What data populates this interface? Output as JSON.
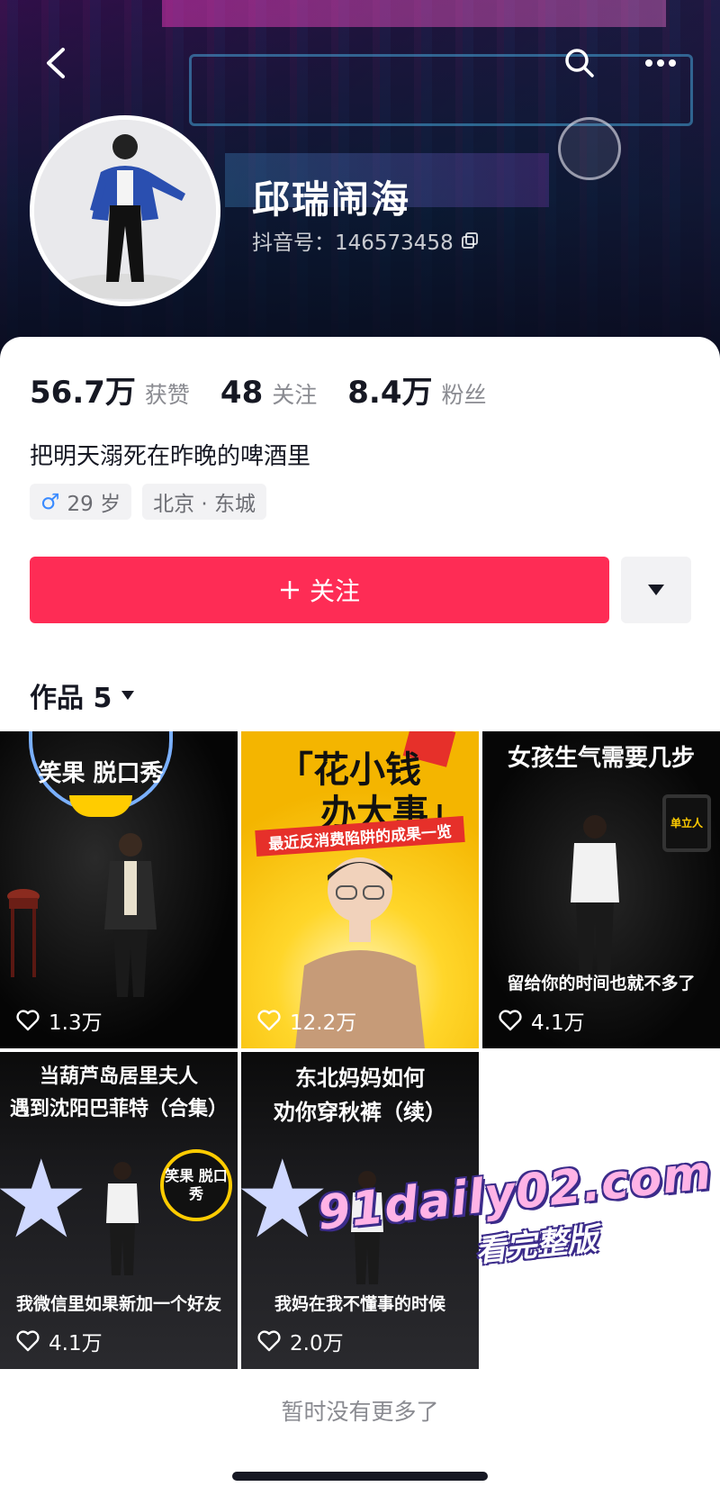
{
  "profile": {
    "nickname": "邱瑞闹海",
    "douyin_id": "抖音号：146573458",
    "bio": "把明天溺死在昨晚的啤酒里",
    "stats": [
      {
        "value": "56.7万",
        "label": "获赞"
      },
      {
        "value": "48",
        "label": "关注"
      },
      {
        "value": "8.4万",
        "label": "粉丝"
      }
    ],
    "tags": {
      "age": "29 岁",
      "location": "北京 · 东城"
    }
  },
  "actions": {
    "follow_label": "关注"
  },
  "works": {
    "header": "作品 5",
    "items": [
      {
        "likes": "1.3万",
        "badge_text": "笑果 脱口秀"
      },
      {
        "likes": "12.2万",
        "headline1": "「花小钱",
        "headline2": "办大事」",
        "subtitle": "最近反消费陷阱的成果一览"
      },
      {
        "likes": "4.1万",
        "title": "女孩生气需要几步",
        "bottom_caption": "留给你的时间也就不多了"
      },
      {
        "likes": "4.1万",
        "title_line1": "当葫芦岛居里夫人",
        "title_line2": "遇到沈阳巴菲特（合集）",
        "bottom_caption": "我微信里如果新加一个好友",
        "badge_text": "笑果 脱口秀"
      },
      {
        "likes": "2.0万",
        "title_line1": "东北妈妈如何",
        "title_line2": "劝你穿秋裤（续）",
        "bottom_caption": "我妈在我不懂事的时候"
      }
    ]
  },
  "watermark": {
    "line1": "91daily02.com",
    "line2": "看完整版"
  },
  "footer": {
    "no_more": "暂时没有更多了"
  },
  "colors": {
    "accent": "#fe2c55",
    "male": "#3a8bff"
  }
}
